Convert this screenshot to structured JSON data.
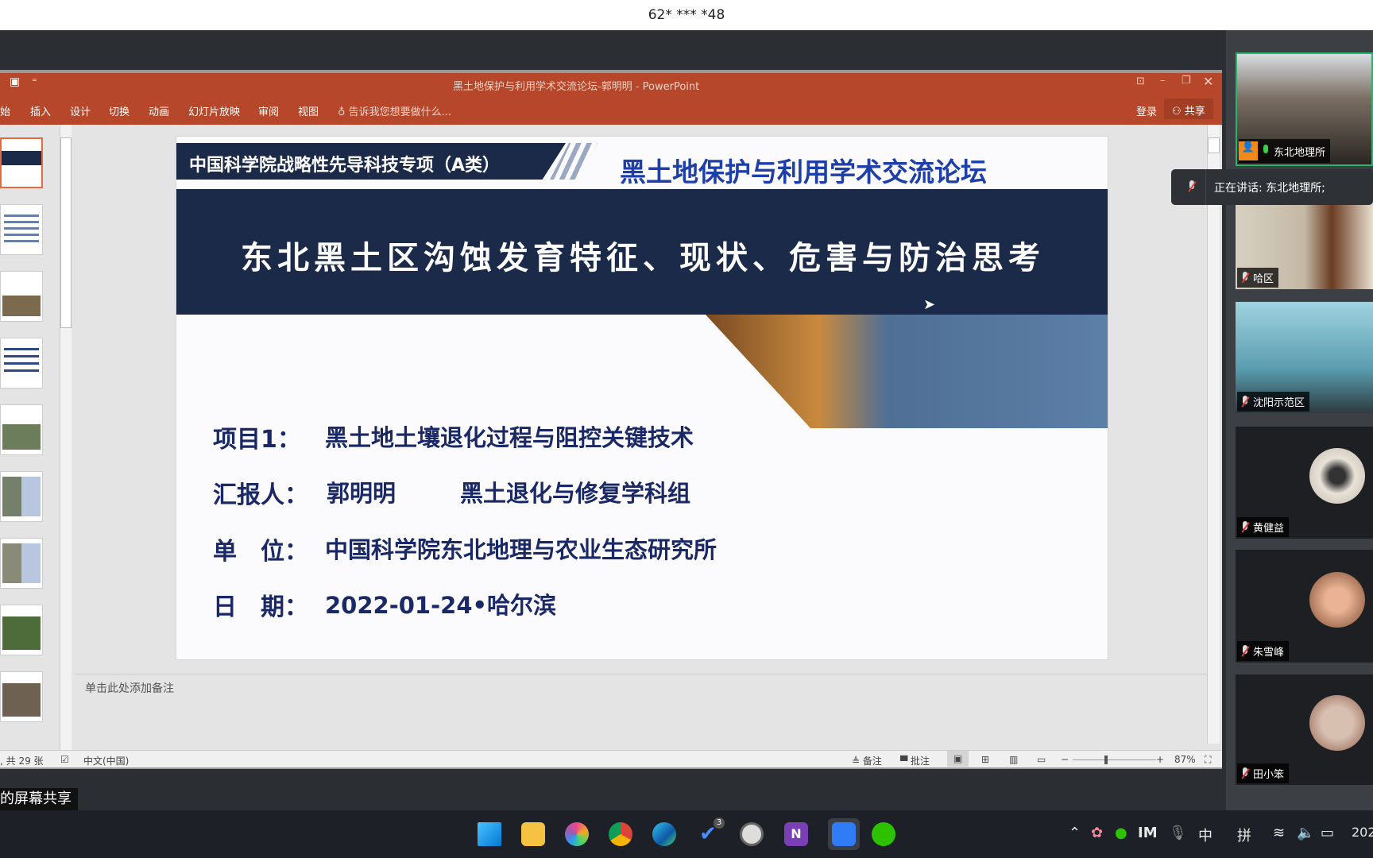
{
  "top_bar": {
    "title": "62* *** *48"
  },
  "powerpoint": {
    "window_title": "黑土地保护与利用学术交流论坛-郭明明 - PowerPoint",
    "ribbon_tabs": [
      "始",
      "插入",
      "设计",
      "切换",
      "动画",
      "幻灯片放映",
      "审阅",
      "视图"
    ],
    "tell_me": "告诉我您想要做什么...",
    "sign_in": "登录",
    "share": "共享",
    "notes_placeholder": "单击此处添加备注",
    "status": {
      "slide_count": ", 共 29 张",
      "language": "中文(中国)",
      "notes": "备注",
      "comments": "批注",
      "zoom": "87%",
      "zoom_level": 0.87
    },
    "thumbnails_selected_index": 0
  },
  "slide": {
    "program_tag": "中国科学院战略性先导科技专项（A类）",
    "forum_title": "黑土地保护与利用学术交流论坛",
    "main_title": "东北黑土区沟蚀发育特征、现状、危害与防治思考",
    "rows": [
      {
        "label": "项目1：",
        "value": "黑土地土壤退化过程与阻控关键技术",
        "extra": ""
      },
      {
        "label": "汇报人：",
        "value": "郭明明",
        "extra": "黑土退化与修复学科组"
      },
      {
        "label": "单　位：",
        "value": "中国科学院东北地理与农业生态研究所",
        "extra": ""
      },
      {
        "label": "日　期：",
        "value": "2022-01-24•哈尔滨",
        "extra": ""
      }
    ],
    "colors": {
      "navy": "#1b2a48",
      "title_blue": "#1e3ea8",
      "text_navy": "#1a2866"
    }
  },
  "meeting": {
    "speaking_tooltip": "正在讲话: 东北地理所;",
    "participants": [
      {
        "name": "东北地理所",
        "mic": "on"
      },
      {
        "name": "哈区",
        "mic": "off"
      },
      {
        "name": "沈阳示范区",
        "mic": "off"
      },
      {
        "name": "黄健益",
        "mic": "off"
      },
      {
        "name": "朱雪峰",
        "mic": "off"
      },
      {
        "name": "田小笨",
        "mic": "off"
      }
    ],
    "share_label": "的屏幕共享"
  },
  "taskbar": {
    "apps": [
      "windows-start",
      "file-explorer",
      "photos",
      "chrome",
      "edge",
      "todo",
      "clock",
      "onenote",
      "tencent-meeting",
      "wechat"
    ],
    "todo_badge": "3",
    "tray": {
      "ime_lang": "中",
      "ime_mode": "拼",
      "clock_partial": "202"
    }
  }
}
